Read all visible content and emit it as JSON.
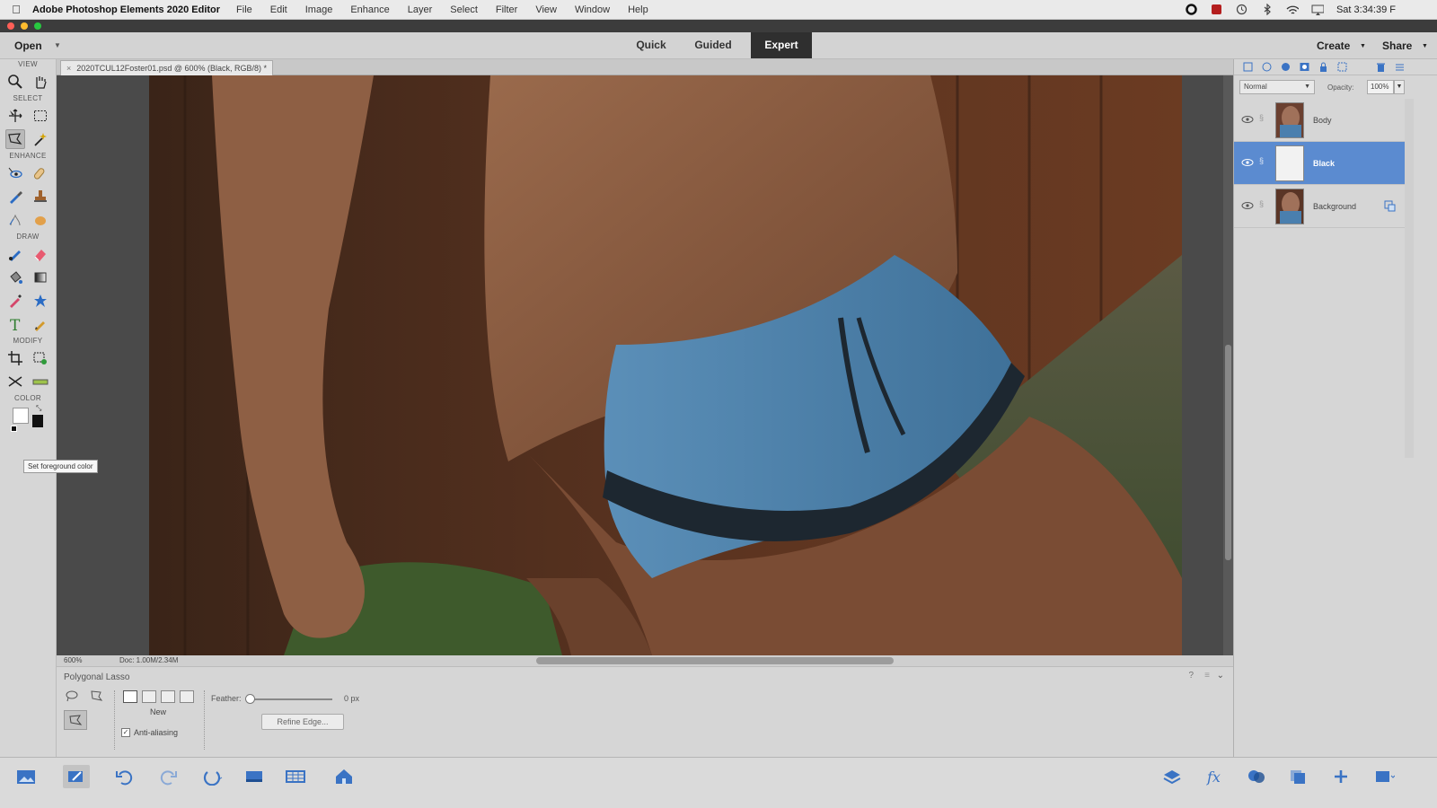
{
  "menubar": {
    "app_name": "Adobe Photoshop Elements 2020 Editor",
    "items": [
      "File",
      "Edit",
      "Image",
      "Enhance",
      "Layer",
      "Select",
      "Filter",
      "View",
      "Window",
      "Help"
    ],
    "clock": "Sat 3:34:39 F"
  },
  "modebar": {
    "open_label": "Open",
    "tabs": [
      {
        "label": "Quick",
        "active": false
      },
      {
        "label": "Guided",
        "active": false
      },
      {
        "label": "Expert",
        "active": true
      }
    ],
    "create_label": "Create",
    "share_label": "Share"
  },
  "toolbox": {
    "sections": {
      "view": "VIEW",
      "select": "SELECT",
      "enhance": "ENHANCE",
      "draw": "DRAW",
      "modify": "MODIFY",
      "color": "COLOR"
    },
    "foreground_color": "#ffffff",
    "background_color": "#111111",
    "tooltip": "Set foreground color"
  },
  "document": {
    "tab_title": "2020TCUL12Foster01.psd @ 600% (Black, RGB/8) *",
    "close_glyph": "×"
  },
  "statusbar": {
    "zoom": "600%",
    "doc_size": "Doc: 1.00M/2.34M"
  },
  "tool_options": {
    "tool_name": "Polygonal Lasso",
    "new_label": "New",
    "anti_alias_label": "Anti-aliasing",
    "anti_alias_checked": true,
    "feather_label": "Feather:",
    "feather_value": "0 px",
    "feather_fraction": 0,
    "refine_edge_label": "Refine Edge..."
  },
  "layers_panel": {
    "blend_mode": "Normal",
    "opacity_label": "Opacity:",
    "opacity_value": "100%",
    "layers": [
      {
        "name": "Body",
        "active": false
      },
      {
        "name": "Black",
        "active": true
      },
      {
        "name": "Background",
        "active": false
      }
    ]
  },
  "colors": {
    "active_tab": "#2f2f2f",
    "selected_layer": "#5b8bd0",
    "panel_bg": "#d6d6d6"
  }
}
